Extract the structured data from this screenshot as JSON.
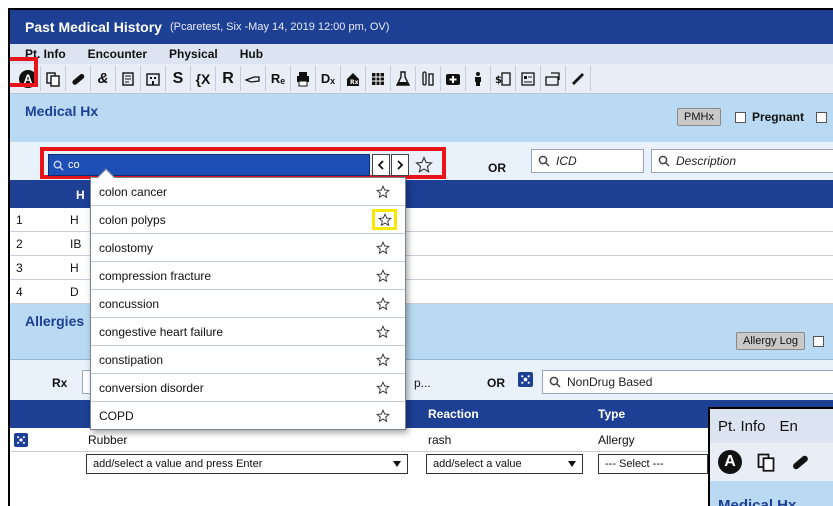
{
  "window": {
    "title": "Past Medical History",
    "subtitle": "(Pcaretest, Six -May 14, 2019 12:00 pm, OV)"
  },
  "menu": [
    "Pt. Info",
    "Encounter",
    "Physical",
    "Hub"
  ],
  "toolbar": {
    "letters": {
      "s": "S",
      "r": "R",
      "re": "Rₑ",
      "dx": "Dₓ"
    }
  },
  "medical_hx": {
    "title": "Medical Hx",
    "pmhx_button": "PMHx",
    "pregnant_label": "Pregnant",
    "search_value": "co",
    "or_label": "OR",
    "icd_placeholder": "ICD",
    "description_placeholder": "Description",
    "header_col": "H",
    "rows": [
      {
        "num": "1",
        "text": "H"
      },
      {
        "num": "2",
        "text": "IB"
      },
      {
        "num": "3",
        "text": "H"
      },
      {
        "num": "4",
        "text": "D"
      }
    ]
  },
  "dropdown": {
    "items": [
      "colon cancer",
      "colon polyps",
      "colostomy",
      "compression fracture",
      "concussion",
      "congestive heart failure",
      "constipation",
      "conversion disorder",
      "COPD"
    ]
  },
  "allergies": {
    "title": "Allergies",
    "allergy_log_button": "Allergy Log",
    "rx_label": "Rx",
    "partial_text": "p...",
    "or_label": "OR",
    "nondrug_placeholder": "NonDrug Based",
    "columns": {
      "reaction": "Reaction",
      "type": "Type"
    },
    "row": {
      "name": "Rubber",
      "reaction": "rash",
      "type": "Allergy"
    },
    "add_value_placeholder": "add/select a value and press Enter",
    "add_reaction_placeholder": "add/select a value",
    "select_placeholder": "--- Select ---"
  },
  "inset": {
    "menu_item": "Pt. Info",
    "menu_item_partial": "En",
    "section_partial": "Medical Hx"
  },
  "colors": {
    "title_bar": "#1d3f94",
    "section_bar": "#b9daf2",
    "highlight_red": "#e8141a",
    "highlight_yellow": "#f7ea00",
    "search_selected": "#1d4fb7"
  }
}
